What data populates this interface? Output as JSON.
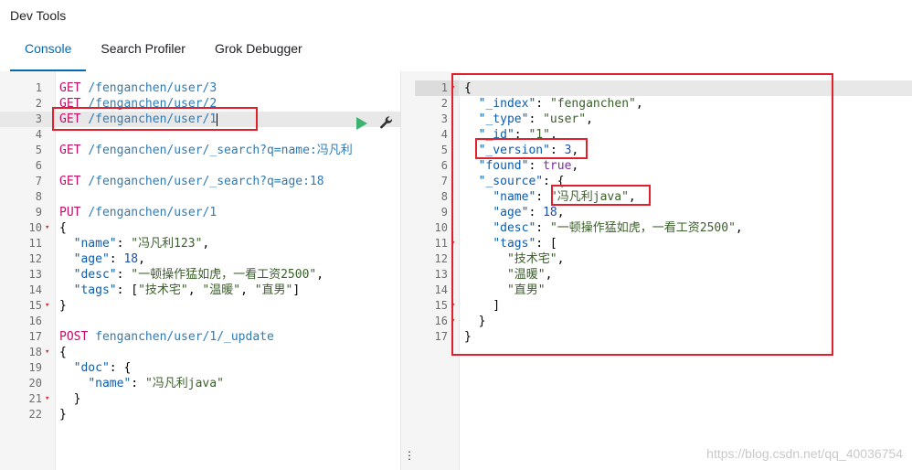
{
  "app": {
    "title": "Dev Tools"
  },
  "tabs": [
    {
      "label": "Console",
      "active": true
    },
    {
      "label": "Search Profiler",
      "active": false
    },
    {
      "label": "Grok Debugger",
      "active": false
    }
  ],
  "request_editor": {
    "lines": [
      {
        "n": "1",
        "t": "GET /fenganchen/user/3"
      },
      {
        "n": "2",
        "t": "GET /fenganchen/user/2"
      },
      {
        "n": "3",
        "t": "GET /fenganchen/user/1"
      },
      {
        "n": "4",
        "t": ""
      },
      {
        "n": "5",
        "t": "GET /fenganchen/user/_search?q=name:冯凡利"
      },
      {
        "n": "6",
        "t": ""
      },
      {
        "n": "7",
        "t": "GET /fenganchen/user/_search?q=age:18"
      },
      {
        "n": "8",
        "t": ""
      },
      {
        "n": "9",
        "t": "PUT /fenganchen/user/1"
      },
      {
        "n": "10",
        "t": "{"
      },
      {
        "n": "11",
        "t": "  \"name\": \"冯凡利123\","
      },
      {
        "n": "12",
        "t": "  \"age\": 18,"
      },
      {
        "n": "13",
        "t": "  \"desc\": \"一顿操作猛如虎，一看工资2500\","
      },
      {
        "n": "14",
        "t": "  \"tags\": [\"技术宅\", \"温暖\", \"直男\"]"
      },
      {
        "n": "15",
        "t": "}"
      },
      {
        "n": "16",
        "t": ""
      },
      {
        "n": "17",
        "t": "POST fenganchen/user/1/_update"
      },
      {
        "n": "18",
        "t": "{"
      },
      {
        "n": "19",
        "t": "  \"doc\": {"
      },
      {
        "n": "20",
        "t": "    \"name\": \"冯凡利java\""
      },
      {
        "n": "21",
        "t": "  }"
      },
      {
        "n": "22",
        "t": "}"
      }
    ]
  },
  "response_viewer": {
    "lines": [
      {
        "n": "1",
        "t": "{"
      },
      {
        "n": "2",
        "t": "  \"_index\": \"fenganchen\","
      },
      {
        "n": "3",
        "t": "  \"_type\": \"user\","
      },
      {
        "n": "4",
        "t": "  \"_id\": \"1\","
      },
      {
        "n": "5",
        "t": "  \"_version\": 3,"
      },
      {
        "n": "6",
        "t": "  \"found\": true,"
      },
      {
        "n": "7",
        "t": "  \"_source\": {"
      },
      {
        "n": "8",
        "t": "    \"name\": \"冯凡利java\","
      },
      {
        "n": "9",
        "t": "    \"age\": 18,"
      },
      {
        "n": "10",
        "t": "    \"desc\": \"一顿操作猛如虎，一看工资2500\","
      },
      {
        "n": "11",
        "t": "    \"tags\": ["
      },
      {
        "n": "12",
        "t": "      \"技术宅\","
      },
      {
        "n": "13",
        "t": "      \"温暖\","
      },
      {
        "n": "14",
        "t": "      \"直男\""
      },
      {
        "n": "15",
        "t": "    ]"
      },
      {
        "n": "16",
        "t": "  }"
      },
      {
        "n": "17",
        "t": "}"
      }
    ]
  },
  "icons": {
    "run": "play-icon",
    "settings": "wrench-icon",
    "resize": "vertical-dots-icon"
  },
  "divider": {
    "grip": "⋮"
  },
  "watermark": "https://blog.csdn.net/qq_40036754",
  "colors": {
    "accent": "#006bb4",
    "annotation": "#e0202a",
    "run": "#3cb371"
  }
}
